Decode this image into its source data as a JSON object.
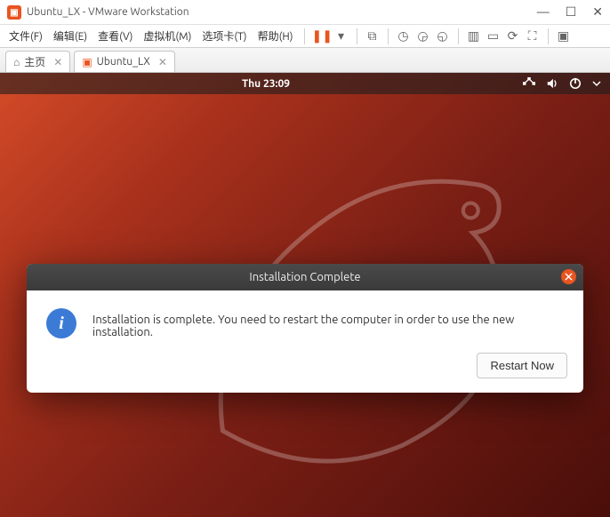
{
  "window": {
    "title": "Ubuntu_LX - VMware Workstation"
  },
  "win_controls": {
    "minimize": "—",
    "maximize": "☐",
    "close": "✕"
  },
  "menubar": {
    "file": "文件(F)",
    "edit": "编辑(E)",
    "view": "查看(V)",
    "vm": "虚拟机(M)",
    "tabs": "选项卡(T)",
    "help": "帮助(H)"
  },
  "tabs": {
    "home": "主页",
    "vm_name": "Ubuntu_LX"
  },
  "ubuntu": {
    "clock": "Thu 23:09"
  },
  "dialog": {
    "title": "Installation Complete",
    "message": "Installation is complete. You need to restart the computer in order to use the new installation.",
    "restart_btn": "Restart Now"
  }
}
